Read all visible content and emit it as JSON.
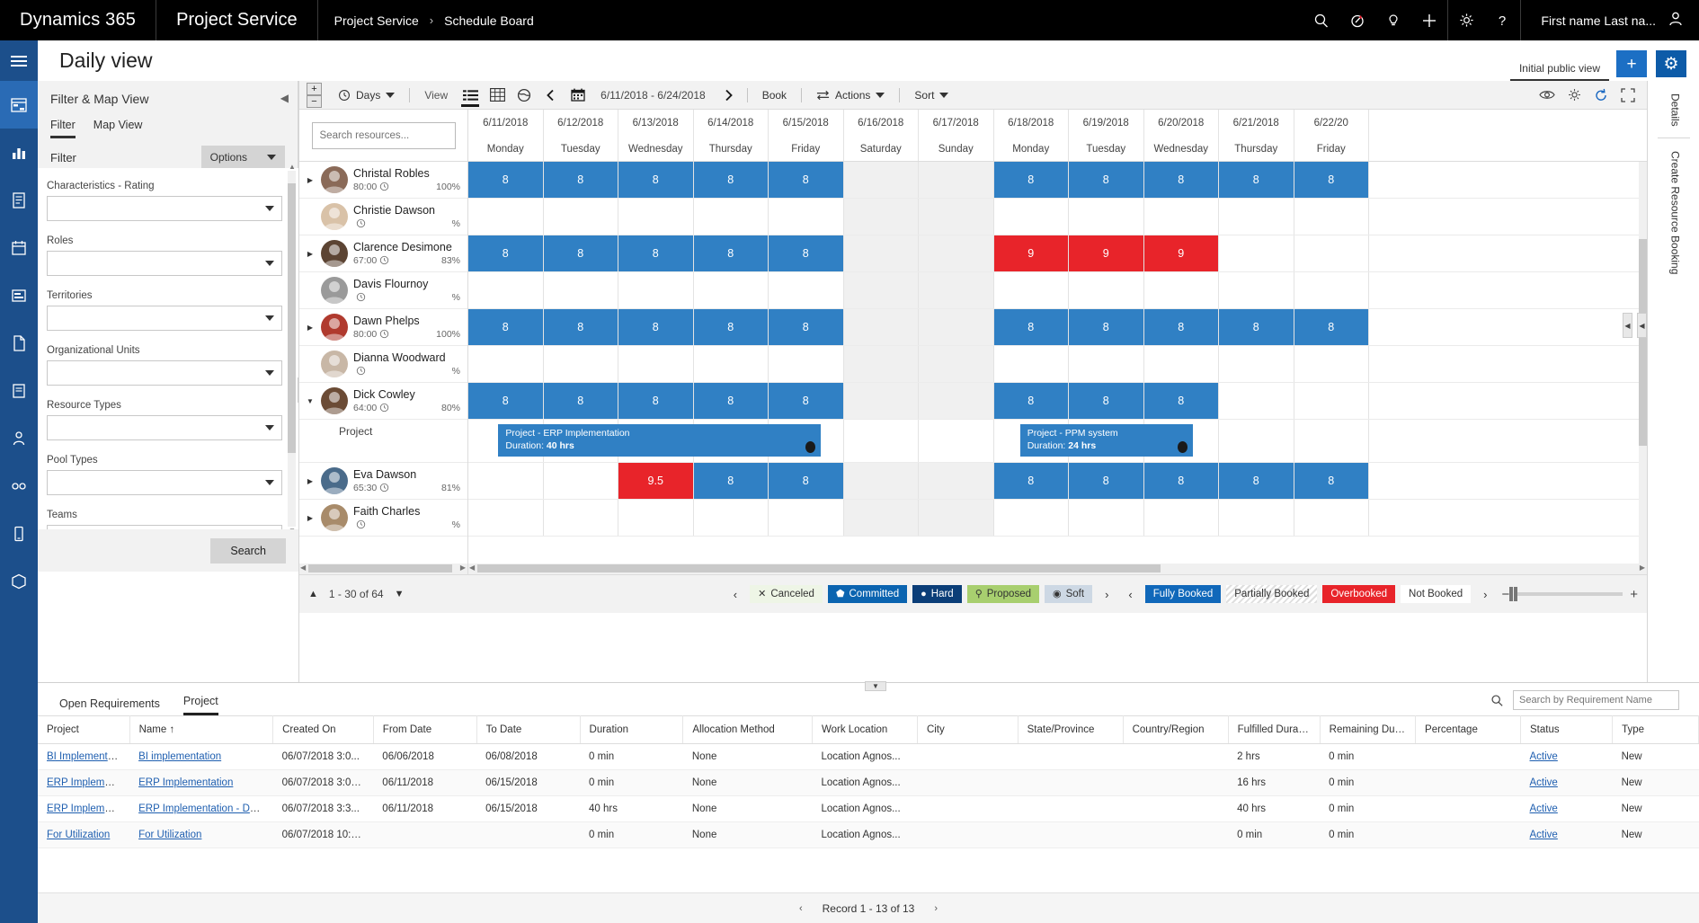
{
  "topnav": {
    "brand": "Dynamics 365",
    "app": "Project Service",
    "breadcrumb": [
      "Project Service",
      "Schedule Board"
    ],
    "separator": "›",
    "icons": [
      "search-icon",
      "progress-icon",
      "lightbulb-icon",
      "plus-icon",
      "gear-icon",
      "help-icon"
    ],
    "user": "First name Last na...",
    "accent": "#1c4f8b"
  },
  "page": {
    "title": "Daily view",
    "view_tab": "Initial public view",
    "add_label": "+",
    "settings_label": "⚙"
  },
  "filter_panel": {
    "header": "Filter & Map View",
    "tabs": [
      {
        "label": "Filter",
        "active": true
      },
      {
        "label": "Map View",
        "active": false
      }
    ],
    "sub_label": "Filter",
    "options_label": "Options",
    "fields": [
      {
        "label": "Characteristics - Rating",
        "value": ""
      },
      {
        "label": "Roles",
        "value": ""
      },
      {
        "label": "Territories",
        "value": ""
      },
      {
        "label": "Organizational Units",
        "value": ""
      },
      {
        "label": "Resource Types",
        "value": ""
      },
      {
        "label": "Pool Types",
        "value": ""
      },
      {
        "label": "Teams",
        "value": ""
      }
    ],
    "search_button": "Search"
  },
  "toolbar": {
    "zoom_in": "+",
    "zoom_out": "−",
    "unit_label": "Days",
    "view_label": "View",
    "view_modes": [
      "list-view-icon",
      "grid-view-icon",
      "map-view-icon"
    ],
    "prev": "‹",
    "next": "›",
    "date_range": "6/11/2018 - 6/24/2018",
    "book_label": "Book",
    "actions_label": "Actions",
    "sort_label": "Sort",
    "right_icons": [
      "eye-icon",
      "gear-icon",
      "refresh-icon",
      "fullscreen-icon"
    ]
  },
  "board": {
    "search_placeholder": "Search resources...",
    "dates": [
      {
        "date": "6/11/2018",
        "day": "Monday",
        "weekend": false
      },
      {
        "date": "6/12/2018",
        "day": "Tuesday",
        "weekend": false
      },
      {
        "date": "6/13/2018",
        "day": "Wednesday",
        "weekend": false
      },
      {
        "date": "6/14/2018",
        "day": "Thursday",
        "weekend": false
      },
      {
        "date": "6/15/2018",
        "day": "Friday",
        "weekend": false
      },
      {
        "date": "6/16/2018",
        "day": "Saturday",
        "weekend": true
      },
      {
        "date": "6/17/2018",
        "day": "Sunday",
        "weekend": true
      },
      {
        "date": "6/18/2018",
        "day": "Monday",
        "weekend": false
      },
      {
        "date": "6/19/2018",
        "day": "Tuesday",
        "weekend": false
      },
      {
        "date": "6/20/2018",
        "day": "Wednesday",
        "weekend": false
      },
      {
        "date": "6/21/2018",
        "day": "Thursday",
        "weekend": false
      },
      {
        "date": "6/22/20",
        "day": "Friday",
        "weekend": false
      }
    ],
    "resources": [
      {
        "name": "Christal Robles",
        "hours": "80:00",
        "pct": "100%",
        "expandable": true,
        "expanded": false,
        "avatar": "#8a6a58",
        "cells": [
          "8",
          "8",
          "8",
          "8",
          "8",
          "",
          "",
          "8",
          "8",
          "8",
          "8",
          "8"
        ],
        "states": [
          "full",
          "full",
          "full",
          "full",
          "full",
          "wknd",
          "wknd",
          "full",
          "full",
          "full",
          "full",
          "full"
        ]
      },
      {
        "name": "Christie Dawson",
        "hours": "",
        "pct": "",
        "expandable": false,
        "expanded": false,
        "avatar": "#d9c2a8",
        "cells": [
          "",
          "",
          "",
          "",
          "",
          "",
          "",
          "",
          "",
          "",
          "",
          ""
        ],
        "states": [
          "empty",
          "empty",
          "empty",
          "empty",
          "empty",
          "wknd",
          "wknd",
          "empty",
          "empty",
          "empty",
          "empty",
          "empty"
        ]
      },
      {
        "name": "Clarence Desimone",
        "hours": "67:00",
        "pct": "83%",
        "expandable": true,
        "expanded": false,
        "avatar": "#5c4433",
        "cells": [
          "8",
          "8",
          "8",
          "8",
          "8",
          "",
          "",
          "9",
          "9",
          "9",
          "",
          ""
        ],
        "states": [
          "full",
          "full",
          "full",
          "full",
          "full",
          "wknd",
          "wknd",
          "over",
          "over",
          "over",
          "empty",
          "empty"
        ]
      },
      {
        "name": "Davis Flournoy",
        "hours": "",
        "pct": "",
        "expandable": false,
        "expanded": false,
        "avatar": "#9a9a9a",
        "cells": [
          "",
          "",
          "",
          "",
          "",
          "",
          "",
          "",
          "",
          "",
          "",
          ""
        ],
        "states": [
          "empty",
          "empty",
          "empty",
          "empty",
          "empty",
          "wknd",
          "wknd",
          "empty",
          "empty",
          "empty",
          "empty",
          "empty"
        ]
      },
      {
        "name": "Dawn Phelps",
        "hours": "80:00",
        "pct": "100%",
        "expandable": true,
        "expanded": false,
        "avatar": "#b03a2e",
        "cells": [
          "8",
          "8",
          "8",
          "8",
          "8",
          "",
          "",
          "8",
          "8",
          "8",
          "8",
          "8"
        ],
        "states": [
          "full",
          "full",
          "full",
          "full",
          "full",
          "wknd",
          "wknd",
          "full",
          "full",
          "full",
          "full",
          "full"
        ]
      },
      {
        "name": "Dianna Woodward",
        "hours": "",
        "pct": "",
        "expandable": false,
        "expanded": false,
        "avatar": "#c8b7a6",
        "cells": [
          "",
          "",
          "",
          "",
          "",
          "",
          "",
          "",
          "",
          "",
          "",
          ""
        ],
        "states": [
          "empty",
          "empty",
          "empty",
          "empty",
          "empty",
          "wknd",
          "wknd",
          "empty",
          "empty",
          "empty",
          "empty",
          "empty"
        ]
      },
      {
        "name": "Dick Cowley",
        "hours": "64:00",
        "pct": "80%",
        "expandable": true,
        "expanded": true,
        "avatar": "#6b4b35",
        "cells": [
          "8",
          "8",
          "8",
          "8",
          "8",
          "",
          "",
          "8",
          "8",
          "8",
          "",
          ""
        ],
        "states": [
          "full",
          "full",
          "full",
          "full",
          "full",
          "wknd",
          "wknd",
          "full",
          "full",
          "full",
          "empty",
          "empty"
        ]
      }
    ],
    "project_row": {
      "label": "Project",
      "bars": [
        {
          "title": "Project - ERP Implementation",
          "duration_label": "Duration:",
          "duration": "40 hrs",
          "start_col": 0.4,
          "span": 4.3
        },
        {
          "title": "Project - PPM system",
          "duration_label": "Duration:",
          "duration": "24 hrs",
          "start_col": 7.35,
          "span": 2.3
        }
      ]
    },
    "resources_after": [
      {
        "name": "Eva Dawson",
        "hours": "65:30",
        "pct": "81%",
        "expandable": true,
        "expanded": false,
        "avatar": "#4a6b8a",
        "cells": [
          "",
          "",
          "9.5",
          "8",
          "8",
          "",
          "",
          "8",
          "8",
          "8",
          "8",
          "8"
        ],
        "states": [
          "empty",
          "empty",
          "over",
          "full",
          "full",
          "wknd",
          "wknd",
          "full",
          "full",
          "full",
          "full",
          "full"
        ]
      },
      {
        "name": "Faith Charles",
        "hours": "",
        "pct": "",
        "expandable": true,
        "expanded": false,
        "avatar": "#a88b6a",
        "cells": [
          "",
          "",
          "",
          "",
          "",
          "",
          "",
          "",
          "",
          "",
          "",
          ""
        ],
        "states": [
          "empty",
          "empty",
          "empty",
          "empty",
          "empty",
          "wknd",
          "wknd",
          "empty",
          "empty",
          "empty",
          "empty",
          "empty"
        ]
      }
    ]
  },
  "legend": {
    "page_range": "1 - 30 of 64",
    "up": "▲",
    "down": "▼",
    "prev": "‹",
    "next": "›",
    "booking_statuses": [
      {
        "label": "Canceled",
        "kind": "cancel",
        "glyph": "✕"
      },
      {
        "label": "Committed",
        "kind": "commit",
        "glyph": "⬟"
      },
      {
        "label": "Hard",
        "kind": "hard",
        "glyph": "●"
      },
      {
        "label": "Proposed",
        "kind": "prop",
        "glyph": "⚲"
      },
      {
        "label": "Soft",
        "kind": "soft",
        "glyph": "◉"
      }
    ],
    "utilization": [
      {
        "label": "Fully Booked",
        "kind": "fully"
      },
      {
        "label": "Partially Booked",
        "kind": "partial"
      },
      {
        "label": "Overbooked",
        "kind": "over"
      },
      {
        "label": "Not Booked",
        "kind": "notb"
      }
    ],
    "zoom_out": "−",
    "zoom_in": "+"
  },
  "right_rail": {
    "details": "Details",
    "create_resource_booking": "Create Resource Booking"
  },
  "bottom": {
    "tabs": [
      {
        "label": "Open Requirements",
        "active": false
      },
      {
        "label": "Project",
        "active": true
      }
    ],
    "search_placeholder": "Search by Requirement Name",
    "search_icon": "search-icon",
    "columns": [
      "Project",
      "Name",
      "Created On",
      "From Date",
      "To Date",
      "Duration",
      "Allocation Method",
      "Work Location",
      "City",
      "State/Province",
      "Country/Region",
      "Fulfilled Durati...",
      "Remaining Dur...",
      "Percentage",
      "Status",
      "Type"
    ],
    "sort_column": "Name",
    "sort_indicator": "↑",
    "rows": [
      {
        "project": "BI Implementati...",
        "name": "BI implementation",
        "created_on": "06/07/2018 3:0...",
        "from_date": "06/06/2018",
        "to_date": "06/08/2018",
        "duration": "0 min",
        "allocation_method": "None",
        "work_location": "Location Agnos...",
        "city": "",
        "state": "",
        "country": "",
        "fulfilled": "2 hrs",
        "remaining": "0 min",
        "percentage": "",
        "status": "Active",
        "type": "New"
      },
      {
        "project": "ERP Implement...",
        "name": "ERP Implementation",
        "created_on": "06/07/2018 3:01...",
        "from_date": "06/11/2018",
        "to_date": "06/15/2018",
        "duration": "0 min",
        "allocation_method": "None",
        "work_location": "Location Agnos...",
        "city": "",
        "state": "",
        "country": "",
        "fulfilled": "16 hrs",
        "remaining": "0 min",
        "percentage": "",
        "status": "Active",
        "type": "New"
      },
      {
        "project": "ERP Implement...",
        "name": "ERP Implementation - Dev...",
        "created_on": "06/07/2018 3:3...",
        "from_date": "06/11/2018",
        "to_date": "06/15/2018",
        "duration": "40 hrs",
        "allocation_method": "None",
        "work_location": "Location Agnos...",
        "city": "",
        "state": "",
        "country": "",
        "fulfilled": "40 hrs",
        "remaining": "0 min",
        "percentage": "",
        "status": "Active",
        "type": "New"
      },
      {
        "project": "For Utilization",
        "name": "For Utilization",
        "created_on": "06/07/2018 10:3...",
        "from_date": "",
        "to_date": "",
        "duration": "0 min",
        "allocation_method": "None",
        "work_location": "Location Agnos...",
        "city": "",
        "state": "",
        "country": "",
        "fulfilled": "0 min",
        "remaining": "0 min",
        "percentage": "",
        "status": "Active",
        "type": "New"
      }
    ],
    "record_counter": "Record 1 - 13 of 13",
    "prev": "‹",
    "next": "›"
  }
}
